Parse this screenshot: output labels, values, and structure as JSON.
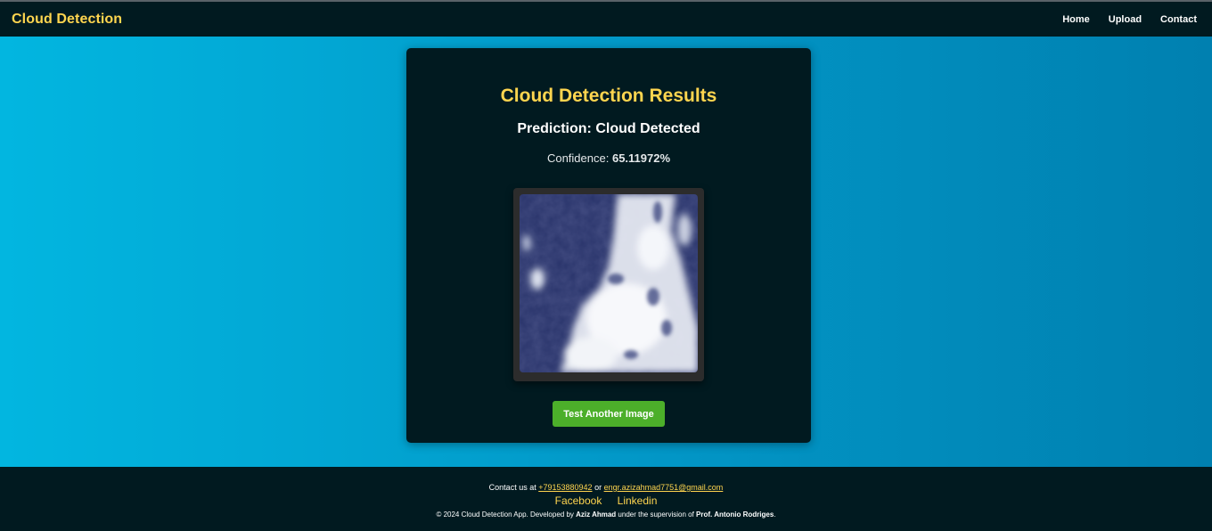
{
  "navbar": {
    "brand": "Cloud Detection",
    "links": [
      "Home",
      "Upload",
      "Contact"
    ]
  },
  "result": {
    "title": "Cloud Detection Results",
    "prediction": "Prediction: Cloud Detected",
    "confidence_label": "Confidence:",
    "confidence_value": "65.11972%",
    "button_label": "Test Another Image"
  },
  "footer": {
    "contact_prefix": "Contact us at",
    "phone": "+79153880942",
    "or_text": "or",
    "email": "engr.azizahmad7751@gmail.com",
    "social": [
      "Facebook",
      "Linkedin"
    ],
    "copyright_prefix": "© 2024 Cloud Detection App. Developed by",
    "developer": "Aziz Ahmad",
    "supervision_text": "under the supervision of",
    "supervisor": "Prof. Antonio Rodriges",
    "period": "."
  },
  "colors": {
    "accent": "#ffd54f",
    "dark_bg": "#011a20",
    "button": "#4caf2a",
    "page_gradient_start": "#02b6e0",
    "page_gradient_end": "#0080b0"
  }
}
